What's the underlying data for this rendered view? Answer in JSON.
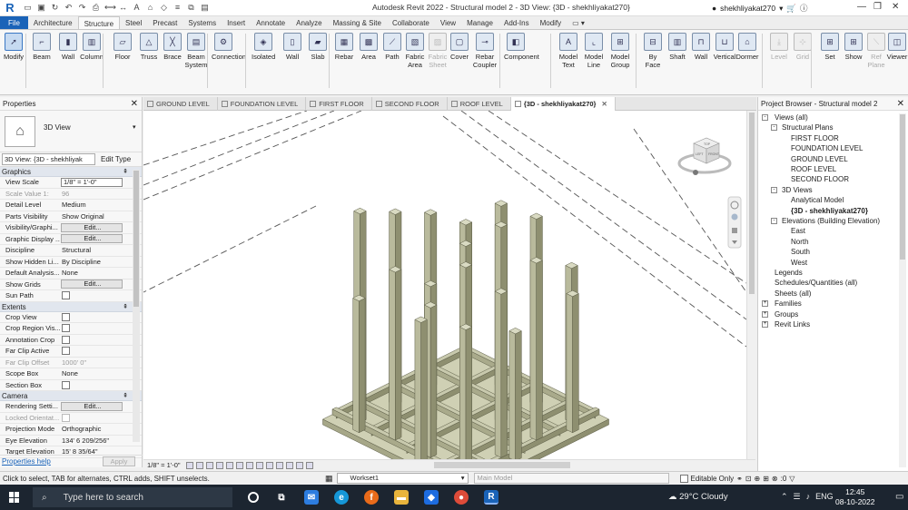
{
  "app": {
    "title": "Autodesk Revit 2022 - Structural model 2 - 3D View: {3D - shekhliyakat270}",
    "user": "shekhliyakat270",
    "logo_letter": "R"
  },
  "ribbon_tabs": [
    "File",
    "Architecture",
    "Structure",
    "Steel",
    "Precast",
    "Systems",
    "Insert",
    "Annotate",
    "Analyze",
    "Massing & Site",
    "Collaborate",
    "View",
    "Manage",
    "Add-Ins",
    "Modify"
  ],
  "ribbon_buttons": [
    {
      "label": "Modify",
      "icon": "cursor-icon"
    },
    {
      "label": "Beam",
      "icon": "beam-icon"
    },
    {
      "label": "Wall",
      "icon": "wall-icon"
    },
    {
      "label": "Column",
      "icon": "column-icon"
    },
    {
      "label": "Floor",
      "icon": "floor-icon"
    },
    {
      "label": "Truss",
      "icon": "truss-icon"
    },
    {
      "label": "Brace",
      "icon": "brace-icon"
    },
    {
      "label": "Beam System",
      "icon": "beam-system-icon"
    },
    {
      "label": "Connection",
      "icon": "connection-icon"
    },
    {
      "label": "Isolated",
      "icon": "isolated-foundation-icon"
    },
    {
      "label": "Wall",
      "icon": "wall-foundation-icon"
    },
    {
      "label": "Slab",
      "icon": "slab-icon"
    },
    {
      "label": "Rebar",
      "icon": "rebar-icon"
    },
    {
      "label": "Area",
      "icon": "area-reinforcement-icon"
    },
    {
      "label": "Path",
      "icon": "path-reinforcement-icon"
    },
    {
      "label": "Fabric Area",
      "icon": "fabric-area-icon"
    },
    {
      "label": "Fabric Sheet",
      "icon": "fabric-sheet-icon"
    },
    {
      "label": "Cover",
      "icon": "cover-icon"
    },
    {
      "label": "Rebar Coupler",
      "icon": "rebar-coupler-icon"
    },
    {
      "label": "Component",
      "icon": "component-icon"
    },
    {
      "label": "Model Text",
      "icon": "model-text-icon"
    },
    {
      "label": "Model Line",
      "icon": "model-line-icon"
    },
    {
      "label": "Model Group",
      "icon": "model-group-icon"
    },
    {
      "label": "By Face",
      "icon": "by-face-icon"
    },
    {
      "label": "Shaft",
      "icon": "shaft-icon"
    },
    {
      "label": "Wall",
      "icon": "wall-opening-icon"
    },
    {
      "label": "Vertical",
      "icon": "vertical-opening-icon"
    },
    {
      "label": "Dormer",
      "icon": "dormer-icon"
    },
    {
      "label": "Level",
      "icon": "level-icon"
    },
    {
      "label": "Grid",
      "icon": "grid-icon"
    },
    {
      "label": "Set",
      "icon": "set-workplane-icon"
    },
    {
      "label": "Show",
      "icon": "show-workplane-icon"
    },
    {
      "label": "Ref Plane",
      "icon": "ref-plane-icon"
    },
    {
      "label": "Viewer",
      "icon": "viewer-icon"
    }
  ],
  "properties": {
    "header": "Properties",
    "type_name": "3D View",
    "instance_selector": "3D View: {3D - shekhliyak",
    "edit_type": "Edit Type",
    "groups": [
      {
        "name": "Graphics",
        "rows": [
          {
            "name": "View Scale",
            "value": "1/8\" = 1'-0\"",
            "kind": "box"
          },
          {
            "name": "Scale Value    1:",
            "value": "96",
            "kind": "dim"
          },
          {
            "name": "Detail Level",
            "value": "Medium",
            "kind": "text"
          },
          {
            "name": "Parts Visibility",
            "value": "Show Original",
            "kind": "text"
          },
          {
            "name": "Visibility/Graphi...",
            "value": "Edit...",
            "kind": "button"
          },
          {
            "name": "Graphic Display ...",
            "value": "Edit...",
            "kind": "button"
          },
          {
            "name": "Discipline",
            "value": "Structural",
            "kind": "text"
          },
          {
            "name": "Show Hidden Li...",
            "value": "By Discipline",
            "kind": "text"
          },
          {
            "name": "Default Analysis...",
            "value": "None",
            "kind": "text"
          },
          {
            "name": "Show Grids",
            "value": "Edit...",
            "kind": "button"
          },
          {
            "name": "Sun Path",
            "value": "",
            "kind": "check"
          }
        ]
      },
      {
        "name": "Extents",
        "rows": [
          {
            "name": "Crop View",
            "value": "",
            "kind": "check"
          },
          {
            "name": "Crop Region Vis...",
            "value": "",
            "kind": "check"
          },
          {
            "name": "Annotation Crop",
            "value": "",
            "kind": "check"
          },
          {
            "name": "Far Clip Active",
            "value": "",
            "kind": "check"
          },
          {
            "name": "Far Clip Offset",
            "value": "1000'  0\"",
            "kind": "dim"
          },
          {
            "name": "Scope Box",
            "value": "None",
            "kind": "text"
          },
          {
            "name": "Section Box",
            "value": "",
            "kind": "check"
          }
        ]
      },
      {
        "name": "Camera",
        "rows": [
          {
            "name": "Rendering Setti...",
            "value": "Edit...",
            "kind": "button"
          },
          {
            "name": "Locked Orientat...",
            "value": "",
            "kind": "checkdim"
          },
          {
            "name": "Projection Mode",
            "value": "Orthographic",
            "kind": "text"
          },
          {
            "name": "Eye Elevation",
            "value": "134'  6 209/256\"",
            "kind": "text"
          },
          {
            "name": "Target Elevation",
            "value": "15'  8 35/64\"",
            "kind": "text"
          }
        ]
      }
    ],
    "help_link": "Properties help",
    "apply": "Apply"
  },
  "view_tabs": [
    {
      "label": "GROUND LEVEL",
      "active": false
    },
    {
      "label": "FOUNDATION LEVEL",
      "active": false
    },
    {
      "label": "FIRST FLOOR",
      "active": false
    },
    {
      "label": "SECOND FLOOR",
      "active": false
    },
    {
      "label": "ROOF LEVEL",
      "active": false
    },
    {
      "label": "{3D - shekhliyakat270}",
      "active": true
    }
  ],
  "view_control": {
    "scale": "1/8\" = 1'-0\""
  },
  "viewcube": {
    "top": "TOP",
    "left": "LEFT",
    "front": "FRONT"
  },
  "project_browser": {
    "header": "Project Browser - Structural model 2",
    "tree": [
      {
        "label": "Views (all)",
        "level": 0,
        "exp": "-"
      },
      {
        "label": "Structural Plans",
        "level": 1,
        "exp": "-"
      },
      {
        "label": "FIRST FLOOR",
        "level": 2
      },
      {
        "label": "FOUNDATION LEVEL",
        "level": 2
      },
      {
        "label": "GROUND LEVEL",
        "level": 2
      },
      {
        "label": "ROOF LEVEL",
        "level": 2
      },
      {
        "label": "SECOND FLOOR",
        "level": 2
      },
      {
        "label": "3D Views",
        "level": 1,
        "exp": "-"
      },
      {
        "label": "Analytical Model",
        "level": 2
      },
      {
        "label": "{3D - shekhliyakat270}",
        "level": 2,
        "bold": true
      },
      {
        "label": "Elevations (Building Elevation)",
        "level": 1,
        "exp": "-"
      },
      {
        "label": "East",
        "level": 2
      },
      {
        "label": "North",
        "level": 2
      },
      {
        "label": "South",
        "level": 2
      },
      {
        "label": "West",
        "level": 2
      },
      {
        "label": "Legends",
        "level": 0
      },
      {
        "label": "Schedules/Quantities (all)",
        "level": 0
      },
      {
        "label": "Sheets (all)",
        "level": 0
      },
      {
        "label": "Families",
        "level": 0,
        "exp": "+"
      },
      {
        "label": "Groups",
        "level": 0,
        "exp": "+"
      },
      {
        "label": "Revit Links",
        "level": 0,
        "exp": "+"
      }
    ]
  },
  "status": {
    "text": "Click to select, TAB for alternates, CTRL adds, SHIFT unselects.",
    "workset": "Workset1",
    "main_model": "Main Model",
    "editable_only": "Editable Only",
    "filter_count": ":0"
  },
  "taskbar": {
    "search_placeholder": "Type here to search",
    "weather": "29°C  Cloudy",
    "lang": "ENG",
    "time": "12:45",
    "date": "08-10-2022"
  },
  "colors": {
    "accent": "#1a63b8",
    "model_fill": "#c8c9ad",
    "model_dark": "#8e8f70",
    "taskbar": "#1c2530"
  }
}
